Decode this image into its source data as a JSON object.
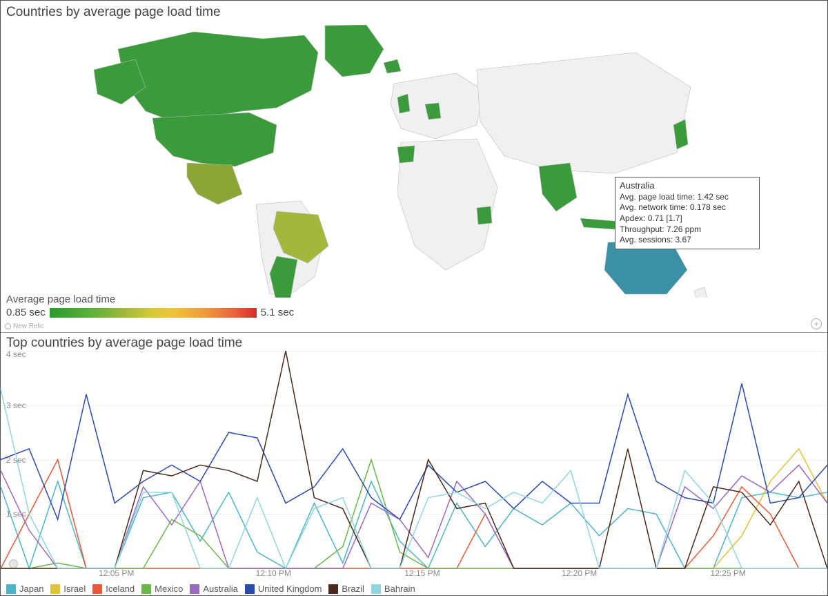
{
  "map": {
    "title": "Countries by average page load time",
    "legend_label": "Average page load time",
    "legend_min": "0.85 sec",
    "legend_max": "5.1 sec",
    "brand": "New Relic"
  },
  "tooltip": {
    "title": "Australia",
    "line1": "Avg. page load time: 1.42 sec",
    "line2": "Avg. network time: 0.178 sec",
    "line3": "Apdex: 0.71 [1.7]",
    "line4": "Throughput: 7.26 ppm",
    "line5": "Avg. sessions: 3.67"
  },
  "chart": {
    "title": "Top countries by average page load time",
    "y_ticks": [
      "4 sec",
      "3 sec",
      "2 sec",
      "1 sec"
    ],
    "x_ticks": [
      "12:05 PM",
      "12:10 PM",
      "12:15 PM",
      "12:20 PM",
      "12:25 PM"
    ],
    "legend": [
      {
        "name": "Japan",
        "color": "#4cb5c9"
      },
      {
        "name": "Israel",
        "color": "#e0c23a"
      },
      {
        "name": "Iceland",
        "color": "#e85a3a"
      },
      {
        "name": "Mexico",
        "color": "#6ab84a"
      },
      {
        "name": "Australia",
        "color": "#9b6abf"
      },
      {
        "name": "United Kingdom",
        "color": "#2a4ab0"
      },
      {
        "name": "Brazil",
        "color": "#4a2a1a"
      },
      {
        "name": "Bahrain",
        "color": "#8fd6e0"
      }
    ]
  },
  "chart_data": {
    "type": "line",
    "title": "Top countries by average page load time",
    "xlabel": "",
    "ylabel": "sec",
    "ylim": [
      0,
      4
    ],
    "x_labels": [
      "12:05 PM",
      "12:10 PM",
      "12:15 PM",
      "12:20 PM",
      "12:25 PM"
    ],
    "x": [
      0,
      1,
      2,
      3,
      4,
      5,
      6,
      7,
      8,
      9,
      10,
      11,
      12,
      13,
      14,
      15,
      16,
      17,
      18,
      19,
      20,
      21,
      22,
      23,
      24,
      25,
      26,
      27,
      28,
      29
    ],
    "series": [
      {
        "name": "Japan",
        "color": "#4cb5c9",
        "values": [
          1.5,
          0.0,
          1.6,
          0.0,
          0.0,
          1.3,
          1.4,
          0.5,
          1.4,
          0.3,
          0.0,
          1.2,
          0.1,
          1.6,
          0.5,
          0.0,
          1.2,
          0.4,
          1.1,
          0.8,
          1.2,
          0.6,
          1.1,
          1.0,
          0.0,
          0.0,
          1.3,
          1.4,
          1.3,
          1.4
        ]
      },
      {
        "name": "Israel",
        "color": "#e0c23a",
        "values": [
          0.0,
          0.0,
          0.0,
          0.0,
          0.0,
          0.0,
          0.0,
          0.0,
          0.0,
          0.0,
          0.0,
          0.0,
          0.0,
          0.0,
          0.0,
          0.0,
          0.0,
          0.0,
          0.0,
          0.0,
          0.0,
          0.0,
          0.0,
          0.0,
          0.0,
          0.0,
          0.6,
          1.6,
          2.2,
          1.2
        ]
      },
      {
        "name": "Iceland",
        "color": "#e85a3a",
        "values": [
          0.0,
          1.0,
          2.0,
          0.0,
          0.0,
          0.0,
          0.0,
          0.0,
          0.0,
          0.0,
          0.0,
          0.0,
          0.0,
          0.0,
          0.0,
          0.0,
          0.0,
          1.0,
          0.0,
          0.0,
          0.0,
          0.0,
          0.0,
          0.0,
          0.0,
          0.6,
          1.5,
          1.0,
          0.0,
          0.0
        ]
      },
      {
        "name": "Mexico",
        "color": "#6ab84a",
        "values": [
          0.0,
          0.0,
          0.1,
          0.0,
          0.0,
          0.0,
          0.9,
          0.6,
          0.0,
          0.0,
          0.0,
          0.0,
          0.4,
          2.0,
          0.3,
          0.0,
          0.0,
          0.0,
          0.0,
          0.0,
          0.0,
          0.0,
          0.0,
          0.0,
          0.0,
          0.0,
          0.0,
          0.0,
          0.0,
          0.0
        ]
      },
      {
        "name": "Australia",
        "color": "#9b6abf",
        "values": [
          1.8,
          0.7,
          0.0,
          0.0,
          0.0,
          1.5,
          0.8,
          1.6,
          0.0,
          0.0,
          0.0,
          0.0,
          0.0,
          1.2,
          0.9,
          0.2,
          1.6,
          1.0,
          0.0,
          0.0,
          0.0,
          0.0,
          0.0,
          0.0,
          1.5,
          1.1,
          1.7,
          1.4,
          1.9,
          1.2
        ]
      },
      {
        "name": "United Kingdom",
        "color": "#2a4ab0",
        "values": [
          2.0,
          2.2,
          0.9,
          3.2,
          1.2,
          1.6,
          1.9,
          1.6,
          2.5,
          2.4,
          1.2,
          1.5,
          2.2,
          1.3,
          0.9,
          1.9,
          1.4,
          1.6,
          1.1,
          1.6,
          1.2,
          1.2,
          3.2,
          1.6,
          1.3,
          1.2,
          3.4,
          1.2,
          1.3,
          1.9
        ]
      },
      {
        "name": "Brazil",
        "color": "#4a2a1a",
        "values": [
          0.0,
          0.0,
          0.0,
          0.0,
          0.0,
          1.8,
          1.7,
          1.9,
          1.8,
          1.6,
          4.0,
          1.3,
          1.1,
          0.0,
          0.0,
          2.0,
          1.1,
          1.2,
          0.0,
          0.0,
          0.0,
          0.0,
          2.2,
          0.0,
          0.0,
          1.5,
          1.4,
          0.8,
          1.6,
          0.0
        ]
      },
      {
        "name": "Bahrain",
        "color": "#8fd6e0",
        "values": [
          3.3,
          1.0,
          0.0,
          0.0,
          0.0,
          1.4,
          1.4,
          0.0,
          0.0,
          1.3,
          0.0,
          1.1,
          1.3,
          0.0,
          0.0,
          1.3,
          1.4,
          1.1,
          1.4,
          1.2,
          1.8,
          0.0,
          0.0,
          0.0,
          1.8,
          1.2,
          0.0,
          0.0,
          0.0,
          0.0
        ]
      }
    ]
  }
}
